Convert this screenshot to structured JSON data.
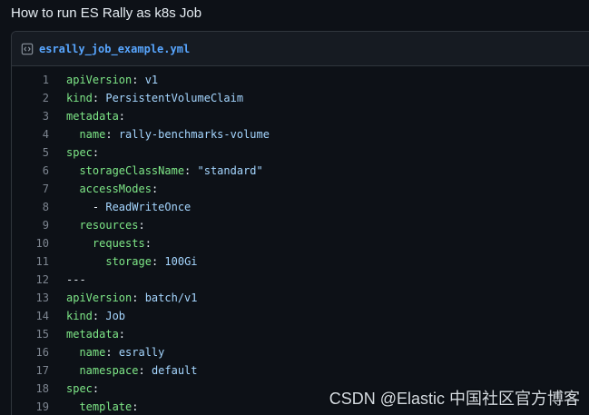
{
  "gist": {
    "title": "How to run ES Rally as k8s Job"
  },
  "file": {
    "icon": "code-file-icon",
    "name": "esrally_job_example.yml"
  },
  "code_lines": [
    {
      "num": "1",
      "indent": "",
      "key": "apiVersion",
      "sep": ": ",
      "value": "v1"
    },
    {
      "num": "2",
      "indent": "",
      "key": "kind",
      "sep": ": ",
      "value": "PersistentVolumeClaim"
    },
    {
      "num": "3",
      "indent": "",
      "key": "metadata",
      "sep": ":",
      "value": ""
    },
    {
      "num": "4",
      "indent": "  ",
      "key": "name",
      "sep": ": ",
      "value": "rally-benchmarks-volume"
    },
    {
      "num": "5",
      "indent": "",
      "key": "spec",
      "sep": ":",
      "value": ""
    },
    {
      "num": "6",
      "indent": "  ",
      "key": "storageClassName",
      "sep": ": ",
      "value": "\"standard\""
    },
    {
      "num": "7",
      "indent": "  ",
      "key": "accessModes",
      "sep": ":",
      "value": ""
    },
    {
      "num": "8",
      "indent": "    ",
      "key": "",
      "sep": "- ",
      "value": "ReadWriteOnce"
    },
    {
      "num": "9",
      "indent": "  ",
      "key": "resources",
      "sep": ":",
      "value": ""
    },
    {
      "num": "10",
      "indent": "    ",
      "key": "requests",
      "sep": ":",
      "value": ""
    },
    {
      "num": "11",
      "indent": "      ",
      "key": "storage",
      "sep": ": ",
      "value": "100Gi"
    },
    {
      "num": "12",
      "indent": "",
      "key": "",
      "sep": "---",
      "value": ""
    },
    {
      "num": "13",
      "indent": "",
      "key": "apiVersion",
      "sep": ": ",
      "value": "batch/v1"
    },
    {
      "num": "14",
      "indent": "",
      "key": "kind",
      "sep": ": ",
      "value": "Job"
    },
    {
      "num": "15",
      "indent": "",
      "key": "metadata",
      "sep": ":",
      "value": ""
    },
    {
      "num": "16",
      "indent": "  ",
      "key": "name",
      "sep": ": ",
      "value": "esrally"
    },
    {
      "num": "17",
      "indent": "  ",
      "key": "namespace",
      "sep": ": ",
      "value": "default"
    },
    {
      "num": "18",
      "indent": "",
      "key": "spec",
      "sep": ":",
      "value": ""
    },
    {
      "num": "19",
      "indent": "  ",
      "key": "template",
      "sep": ":",
      "value": ""
    }
  ],
  "watermark": {
    "text": "CSDN @Elastic 中国社区官方博客"
  },
  "colors": {
    "background": "#0d1117",
    "header_bg": "#161b22",
    "border": "#30363d",
    "key": "#7ee787",
    "value": "#a5d6ff",
    "line_number": "#7d8590",
    "file_name": "#58a6ff"
  }
}
